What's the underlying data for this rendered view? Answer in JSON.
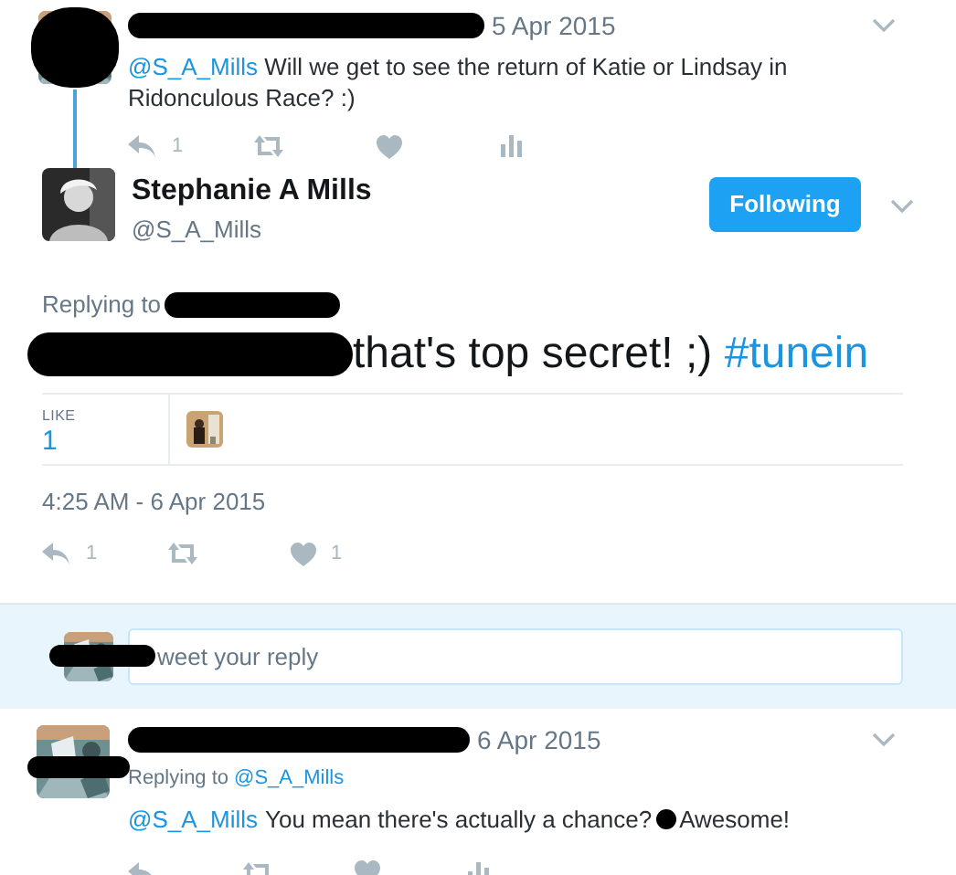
{
  "parent_tweet": {
    "date": "5 Apr 2015",
    "mention": "@S_A_Mills",
    "text": "Will we get to see the return of Katie or Lindsay in Ridonculous Race? :)",
    "actions": [
      {
        "kind": "reply",
        "count": "1"
      },
      {
        "kind": "retweet"
      },
      {
        "kind": "like"
      },
      {
        "kind": "analytics"
      }
    ]
  },
  "main_tweet": {
    "name": "Stephanie A Mills",
    "handle": "@S_A_Mills",
    "follow_button": "Following",
    "replying_label": "Replying to",
    "text": "that's top secret! ;)",
    "hashtag": "#tunein",
    "likes_label": "LIKE",
    "likes_count": "1",
    "timestamp": "4:25 AM - 6 Apr 2015",
    "actions": [
      {
        "kind": "reply",
        "count": "1"
      },
      {
        "kind": "retweet"
      },
      {
        "kind": "like",
        "count": "1"
      }
    ]
  },
  "reply_box": {
    "placeholder": "weet your reply"
  },
  "reply_tweet": {
    "date": "6 Apr 2015",
    "replying_label": "Replying to",
    "replying_to": "@S_A_Mills",
    "mention": "@S_A_Mills",
    "text": "You mean there's actually a chance?",
    "text_end": "Awesome!",
    "actions": [
      {
        "kind": "reply"
      },
      {
        "kind": "retweet"
      },
      {
        "kind": "like"
      },
      {
        "kind": "analytics"
      }
    ]
  }
}
